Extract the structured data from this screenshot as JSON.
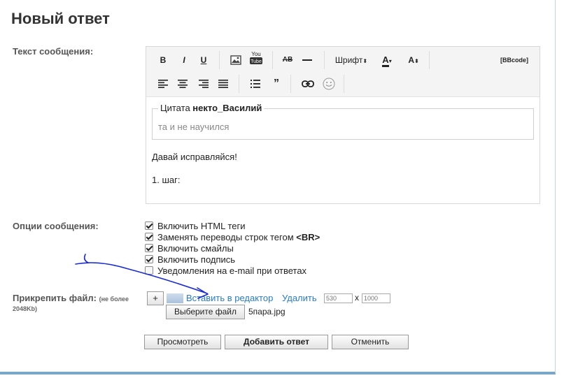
{
  "page": {
    "title": "Новый ответ"
  },
  "message": {
    "label": "Текст сообщения:",
    "toolbar": {
      "bold": "B",
      "italic": "I",
      "underline": "U",
      "youtube": "You Tube",
      "strike": "AB",
      "font": "Шрифт",
      "font_color": "A",
      "font_size": "A",
      "bbcode": "[BBcode]"
    },
    "quote": {
      "label": "Цитата",
      "author": "некто_Василий",
      "text": "та и не научился"
    },
    "lines": [
      "Давай исправляйся!",
      "1. шаг:"
    ]
  },
  "options": {
    "label": "Опции сообщения:",
    "items": [
      {
        "text": "Включить HTML теги",
        "checked": true
      },
      {
        "text": "Заменять переводы строк тегом",
        "bold_suffix": "<BR>",
        "checked": true
      },
      {
        "text": "Включить смайлы",
        "checked": true
      },
      {
        "text": "Включить подпись",
        "checked": true
      },
      {
        "text": "Уведомления на e-mail при ответах",
        "checked": false
      }
    ]
  },
  "attach": {
    "label": "Прикрепить файл:",
    "note_line1": "(не более",
    "note_line2": "2048Kb)",
    "plus": "+",
    "insert_link": "Вставить в редактор",
    "delete_link": "Удалить",
    "width_placeholder": "530",
    "height_placeholder": "1000",
    "x_sep": "x",
    "choose_file": "Выберите файл",
    "file_name": "5пара.jpg"
  },
  "actions": {
    "preview": "Просмотреть",
    "submit": "Добавить ответ",
    "cancel": "Отменить"
  },
  "colors": {
    "link": "#2a7bc8",
    "annotation": "#1a2bd0",
    "frame_bottom": "#7aa7c7"
  },
  "icons": [
    "image-icon",
    "youtube-icon",
    "strike-icon",
    "hr-icon",
    "align-left-icon",
    "align-center-icon",
    "align-right-icon",
    "align-justify-icon",
    "list-icon",
    "quote-icon",
    "link-icon",
    "smile-icon",
    "hand-drawn-arrow-icon"
  ]
}
